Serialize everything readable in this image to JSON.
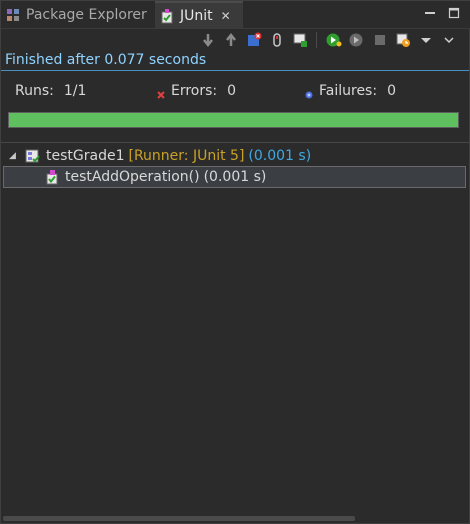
{
  "tabs": {
    "package_explorer": "Package Explorer",
    "junit": "JUnit",
    "close_symbol": "✕"
  },
  "toolbar_icons": [
    "next-failure-icon",
    "previous-failure-icon",
    "show-failures-only-icon",
    "scroll-lock-icon",
    "show-skipped-icon",
    "rerun-test-icon",
    "rerun-failed-first-icon",
    "stop-icon",
    "test-run-history-icon",
    "view-menu-icon"
  ],
  "status": {
    "finished": "Finished after 0.077 seconds"
  },
  "counters": {
    "runs_label": "Runs:",
    "runs_value": "1/1",
    "errors_label": "Errors:",
    "errors_value": "0",
    "failures_label": "Failures:",
    "failures_value": "0"
  },
  "progress": {
    "fraction": 1.0,
    "color": "#5fc05f"
  },
  "tree": {
    "suite_name": "testGrade1",
    "suite_runner": "[Runner: JUnit 5]",
    "suite_time": "(0.001 s)",
    "test_name": "testAddOperation()",
    "test_time": "(0.001 s)"
  },
  "colors": {
    "status_text": "#8fd3ff",
    "runner_text": "#c9a227",
    "suite_time_text": "#3fa9e0",
    "success_green": "#5fc05f"
  }
}
